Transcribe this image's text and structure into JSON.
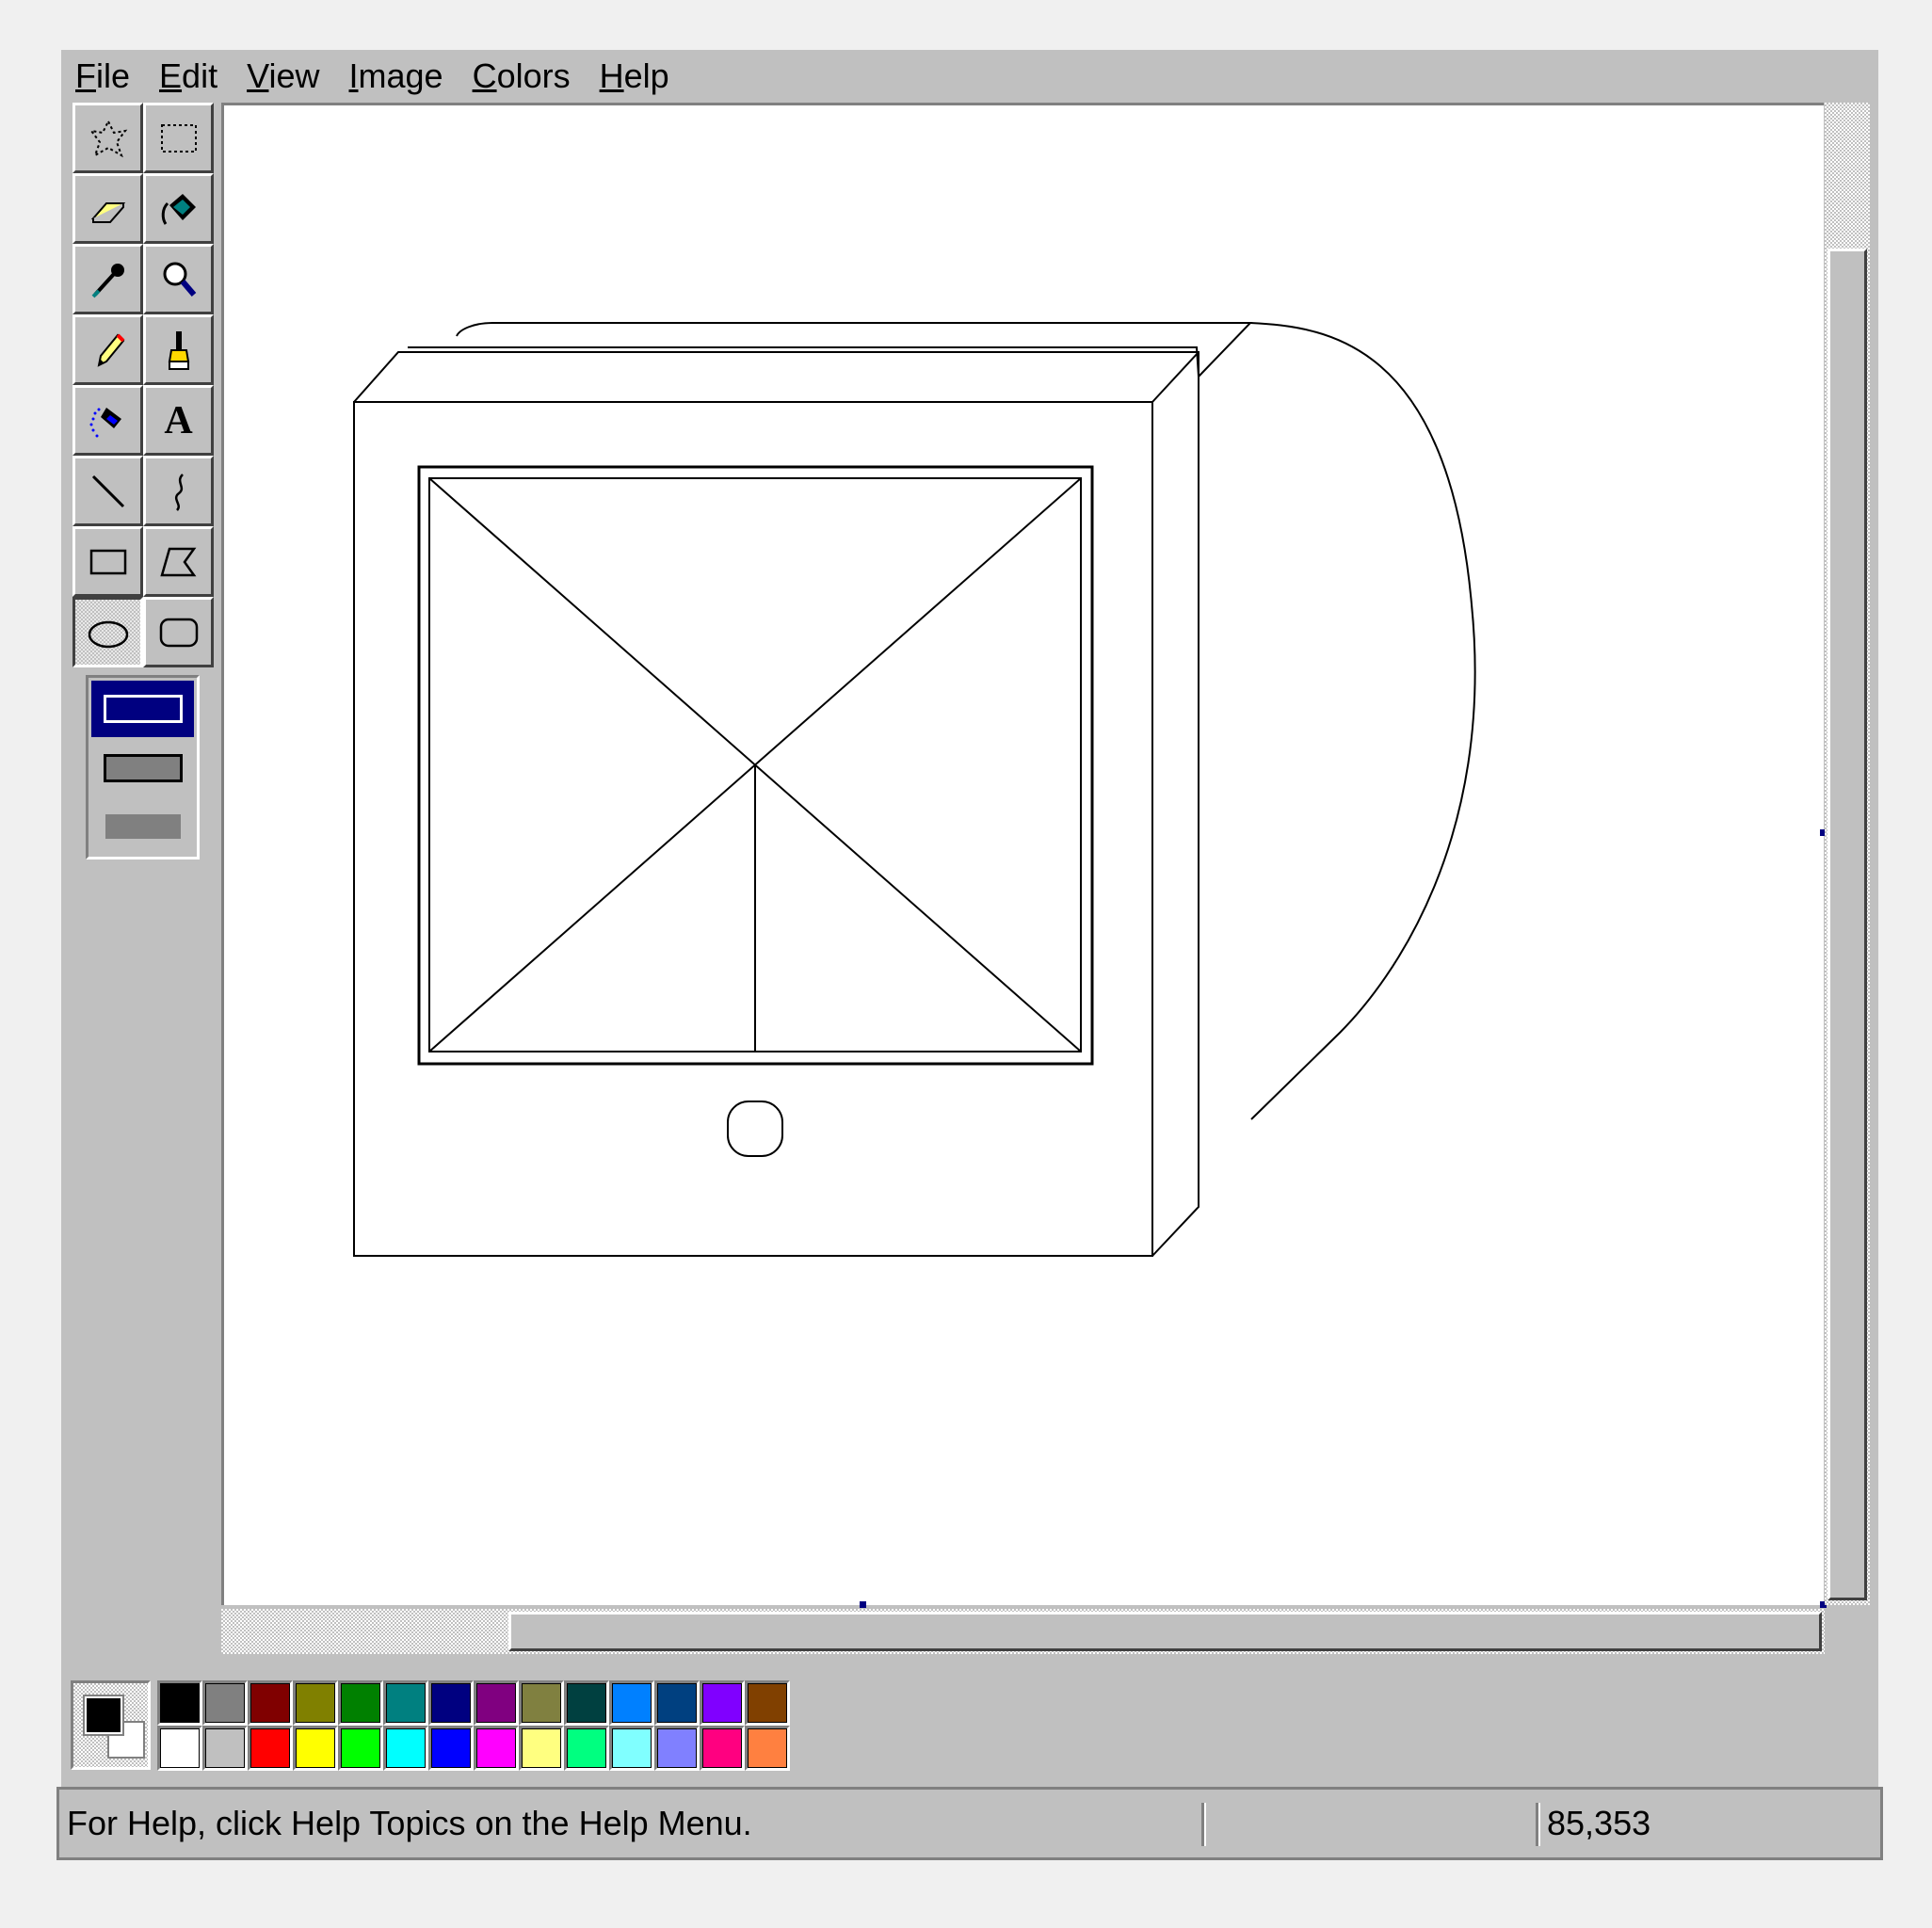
{
  "menu": {
    "file": {
      "u": "F",
      "rest": "ile"
    },
    "edit": {
      "u": "E",
      "rest": "dit"
    },
    "view": {
      "u": "V",
      "rest": "iew"
    },
    "image": {
      "u": "I",
      "rest": "mage"
    },
    "colors": {
      "u": "C",
      "rest": "olors"
    },
    "help": {
      "u": "H",
      "rest": "elp"
    }
  },
  "toolbox": {
    "tools": [
      {
        "icon": "free-form-select-icon"
      },
      {
        "icon": "rect-select-icon"
      },
      {
        "icon": "eraser-icon"
      },
      {
        "icon": "fill-bucket-icon"
      },
      {
        "icon": "color-picker-icon"
      },
      {
        "icon": "magnifier-icon"
      },
      {
        "icon": "pencil-icon"
      },
      {
        "icon": "brush-icon"
      },
      {
        "icon": "airbrush-icon"
      },
      {
        "icon": "text-icon",
        "glyph": "A"
      },
      {
        "icon": "line-icon"
      },
      {
        "icon": "curve-icon"
      },
      {
        "icon": "rectangle-icon"
      },
      {
        "icon": "polygon-icon"
      },
      {
        "icon": "ellipse-icon",
        "active": true
      },
      {
        "icon": "rounded-rect-icon"
      }
    ],
    "fill_options": [
      "outline",
      "outline-and-fill",
      "fill-only"
    ],
    "selected_fill_option": "outline"
  },
  "colors": {
    "foreground": "#000000",
    "background": "#ffffff",
    "palette": [
      "#000000",
      "#808080",
      "#800000",
      "#808000",
      "#008000",
      "#008080",
      "#000080",
      "#800080",
      "#808040",
      "#004040",
      "#0080ff",
      "#004080",
      "#8000ff",
      "#804000",
      "#ffffff",
      "#c0c0c0",
      "#ff0000",
      "#ffff00",
      "#00ff00",
      "#00ffff",
      "#0000ff",
      "#ff00ff",
      "#ffff80",
      "#00ff80",
      "#80ffff",
      "#8080ff",
      "#ff0080",
      "#ff8040"
    ]
  },
  "status": {
    "help_text": "For Help, click Help Topics on the Help Menu.",
    "size_text": "",
    "coords": "85,353"
  }
}
